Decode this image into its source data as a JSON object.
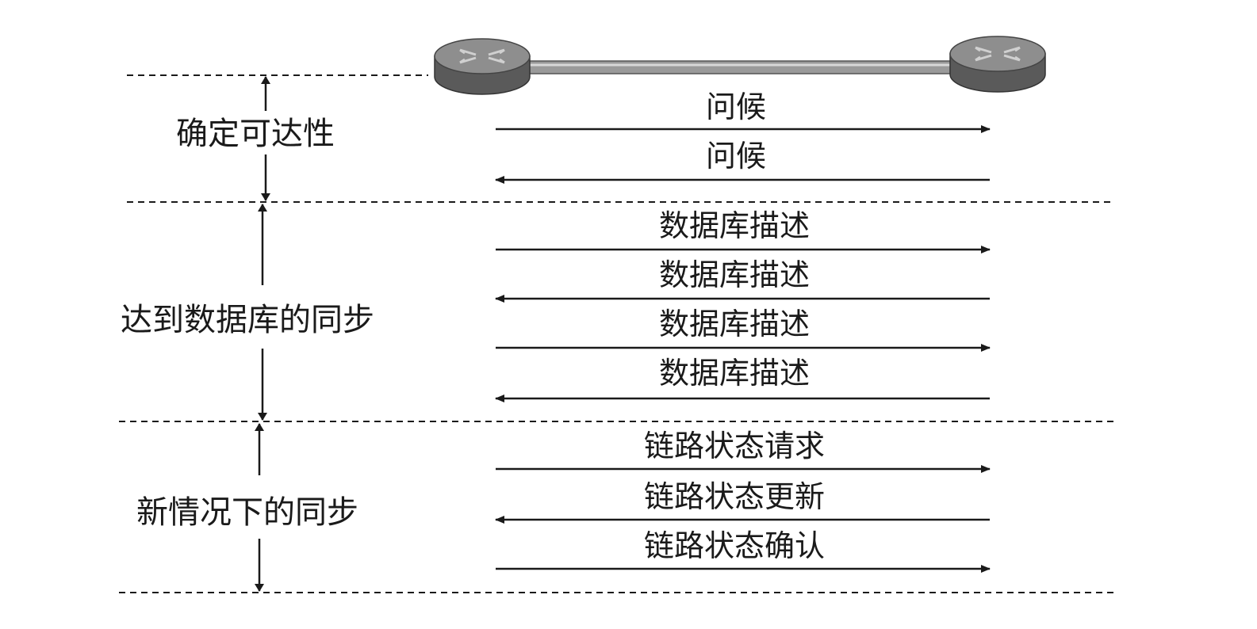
{
  "colors": {
    "ink": "#1a1a1a",
    "router_top": "#8e8e8e",
    "router_side": "#5a5a5a",
    "cable": "#9a9a9a"
  },
  "topology": {
    "left_router_icon": "router-icon",
    "right_router_icon": "router-icon",
    "link": "cable"
  },
  "phases": [
    {
      "label": "确定可达性"
    },
    {
      "label": "达到数据库的同步"
    },
    {
      "label": "新情况下的同步"
    }
  ],
  "messages": [
    {
      "label": "问候",
      "direction": "right"
    },
    {
      "label": "问候",
      "direction": "left"
    },
    {
      "label": "数据库描述",
      "direction": "right"
    },
    {
      "label": "数据库描述",
      "direction": "left"
    },
    {
      "label": "数据库描述",
      "direction": "right"
    },
    {
      "label": "数据库描述",
      "direction": "left"
    },
    {
      "label": "链路状态请求",
      "direction": "right"
    },
    {
      "label": "链路状态更新",
      "direction": "left"
    },
    {
      "label": "链路状态确认",
      "direction": "right"
    }
  ]
}
